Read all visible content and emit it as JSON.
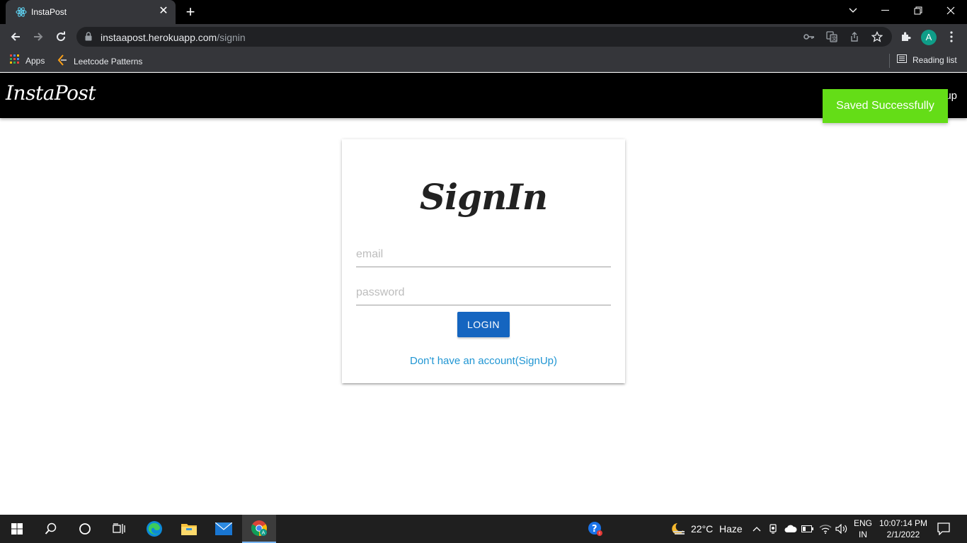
{
  "browser": {
    "tab": {
      "title": "InstaPost",
      "favicon": "react-icon",
      "close": "✕"
    },
    "new_tab": "+",
    "url_host": "instaapost.herokuapp.com",
    "url_path": "/signin",
    "profile_initial": "A",
    "bookmarks": [
      {
        "label": "Apps",
        "icon": "apps-grid-icon"
      },
      {
        "label": "Leetcode Patterns",
        "icon": "leetcode-icon"
      }
    ],
    "reading_list": "Reading list"
  },
  "app": {
    "brand": "InstaPost",
    "nav_right_partial": "up"
  },
  "toast": {
    "message": "Saved Successfully",
    "color": "#64dd17"
  },
  "signin": {
    "title": "SignIn",
    "email_placeholder": "email",
    "email_value": "",
    "password_placeholder": "password",
    "password_value": "",
    "login_label": "LOGIN",
    "signup_link": "Don't have an account(SignUp)",
    "accent_color": "#1565c0",
    "link_color": "#2196d3"
  },
  "taskbar": {
    "weather_temp": "22°C",
    "weather_desc": "Haze",
    "lang_1": "ENG",
    "lang_2": "IN",
    "time": "10:07:14 PM",
    "date": "2/1/2022"
  }
}
